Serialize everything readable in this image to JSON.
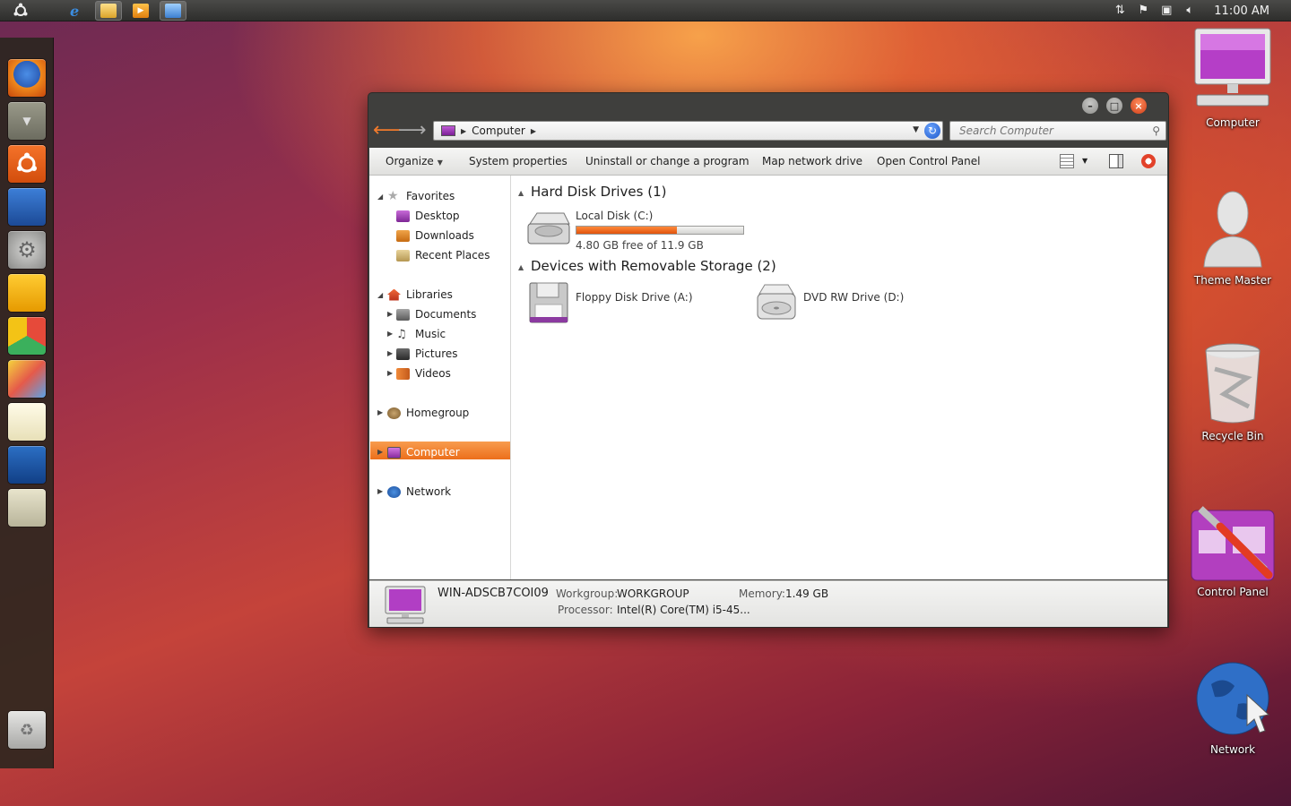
{
  "top_panel": {
    "clock": "11:00 AM",
    "apps": [
      {
        "name": "ubuntu-menu-icon"
      },
      {
        "name": "internet-explorer-icon"
      },
      {
        "name": "file-explorer-icon"
      },
      {
        "name": "media-player-icon"
      },
      {
        "name": "control-panel-icon"
      }
    ]
  },
  "launcher": {
    "items": [
      "firefox-icon",
      "dropdown-icon",
      "ubuntu-logo-icon",
      "presentation-icon",
      "settings-icon",
      "people-icon",
      "chrome-icon",
      "paint-icon",
      "notepad-icon",
      "office-icon",
      "calculator-icon",
      "trash-icon"
    ]
  },
  "window": {
    "address": {
      "location": "Computer"
    },
    "search": {
      "placeholder": "Search Computer"
    },
    "toolbar": {
      "organize": "Organize",
      "system_properties": "System properties",
      "uninstall": "Uninstall or change a program",
      "map_drive": "Map network drive",
      "control_panel": "Open Control Panel"
    },
    "nav_pane": {
      "favorites": "Favorites",
      "desktop": "Desktop",
      "downloads": "Downloads",
      "recent_places": "Recent Places",
      "libraries": "Libraries",
      "documents": "Documents",
      "music": "Music",
      "pictures": "Pictures",
      "videos": "Videos",
      "homegroup": "Homegroup",
      "computer": "Computer",
      "network": "Network"
    },
    "main": {
      "hard_disk_header": "Hard Disk Drives (1)",
      "local_disk": {
        "name": "Local Disk (C:)",
        "free": "4.80 GB free of 11.9 GB",
        "used_fraction": 0.6
      },
      "removable_header": "Devices with Removable Storage (2)",
      "floppy": "Floppy Disk Drive (A:)",
      "dvd": "DVD RW Drive (D:)"
    },
    "status": {
      "computer_name": "WIN-ADSCB7COI09",
      "workgroup_label": "Workgroup:",
      "workgroup": "WORKGROUP",
      "memory_label": "Memory:",
      "memory": "1.49 GB",
      "processor_label": "Processor:",
      "processor": "Intel(R) Core(TM) i5-45..."
    }
  },
  "desktop_icons": {
    "computer": "Computer",
    "theme_master": "Theme Master",
    "recycle_bin": "Recycle Bin",
    "control_panel": "Control Panel",
    "network": "Network"
  },
  "colors": {
    "accent": "#ec6f1b",
    "panel": "#3a3a38"
  }
}
